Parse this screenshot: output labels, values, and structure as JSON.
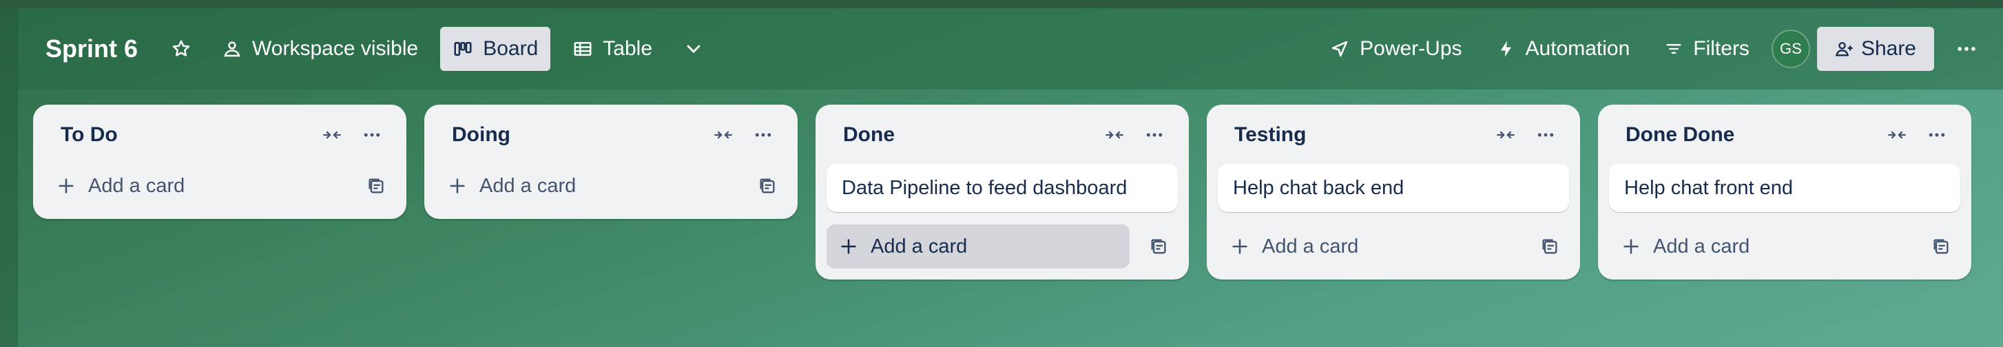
{
  "header": {
    "title": "Sprint 6",
    "visibility": "Workspace visible",
    "views": [
      "Board",
      "Table"
    ],
    "powerups": "Power-Ups",
    "automation": "Automation",
    "filters": "Filters",
    "avatar_initials": "GS",
    "share": "Share"
  },
  "add_card_label": "Add a card",
  "lists": [
    {
      "title": "To Do",
      "cards": []
    },
    {
      "title": "Doing",
      "cards": []
    },
    {
      "title": "Done",
      "cards": [
        "Data Pipeline to feed dashboard"
      ]
    },
    {
      "title": "Testing",
      "cards": [
        "Help chat back end"
      ]
    },
    {
      "title": "Done Done",
      "cards": [
        "Help chat front end"
      ]
    }
  ],
  "colors": {
    "text_dark": "#172b4d",
    "text_muted": "#44546f",
    "list_bg": "#f1f2f4",
    "button_active": "#dfe1e6"
  }
}
